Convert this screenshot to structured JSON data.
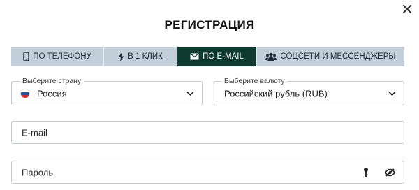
{
  "dialog": {
    "title": "РЕГИСТРАЦИЯ",
    "close_icon": "close-icon"
  },
  "tabs": [
    {
      "label": "ПО ТЕЛЕФОНУ",
      "icon": "phone-icon",
      "active": false
    },
    {
      "label": "В 1 КЛИК",
      "icon": "lightning-icon",
      "active": false
    },
    {
      "label": "ПО E-MAIL",
      "icon": "envelope-icon",
      "active": true
    },
    {
      "label": "СОЦСЕТИ И МЕССЕНДЖЕРЫ",
      "icon": "users-icon",
      "active": false
    }
  ],
  "form": {
    "country": {
      "legend": "Выберите страну",
      "value": "Россия",
      "flag_icon": "russia-flag-icon",
      "flag_colors": [
        "#ffffff",
        "#1c57a5",
        "#d52b1e"
      ]
    },
    "currency": {
      "legend": "Выберите валюту",
      "value": "Российский рубль (RUB)"
    },
    "email": {
      "placeholder": "E-mail",
      "value": ""
    },
    "password": {
      "placeholder": "Пароль",
      "value": "",
      "generate_icon": "key-icon",
      "visibility_icon": "eye-slash-icon"
    }
  },
  "colors": {
    "active_tab": "#0f3b2f",
    "tab_bar": "#c3d0dc",
    "border": "#c4c9cf"
  }
}
